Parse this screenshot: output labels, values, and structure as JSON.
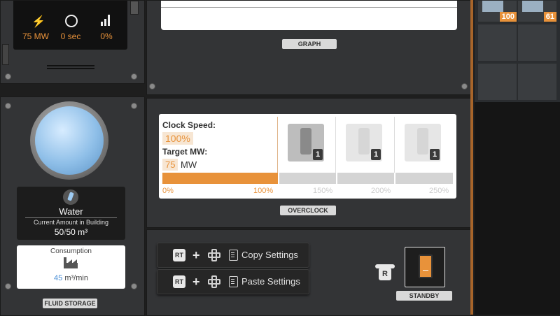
{
  "stats": {
    "power": {
      "icon": "lightning-icon",
      "value": "75 MW"
    },
    "time": {
      "icon": "stopwatch-icon",
      "value": "0 sec"
    },
    "productivity": {
      "icon": "bar-chart-icon",
      "value": "0%"
    }
  },
  "graph_tag": "GRAPH",
  "overclock": {
    "clock_speed_label": "Clock Speed:",
    "clock_speed_value": "100%",
    "target_mw_label": "Target MW:",
    "target_mw_value": "75",
    "target_mw_unit": "MW",
    "progress_fraction": 0.25,
    "scale": [
      "0%",
      "100%",
      "150%",
      "200%",
      "250%"
    ],
    "shards": [
      {
        "count": "1",
        "active": true
      },
      {
        "count": "1",
        "active": false
      },
      {
        "count": "1",
        "active": false
      }
    ],
    "tag": "OVERCLOCK"
  },
  "fluid": {
    "name": "Water",
    "amount_label": "Current Amount in Building",
    "current": "50",
    "separator": "/",
    "capacity": "50 m³",
    "consumption_label": "Consumption",
    "consumption_value": "45",
    "consumption_unit": "m³/min",
    "tag": "FLUID STORAGE"
  },
  "settings": {
    "copy": {
      "button": "RT",
      "label": "Copy Settings"
    },
    "paste": {
      "button": "RT",
      "label": "Paste Settings"
    }
  },
  "standby": {
    "key": "R",
    "tag": "STANDBY"
  },
  "inventory": {
    "counts": [
      "100",
      "61"
    ]
  },
  "colors": {
    "accent": "#e8923a",
    "panel": "#333436",
    "background": "#1e1e1e"
  }
}
